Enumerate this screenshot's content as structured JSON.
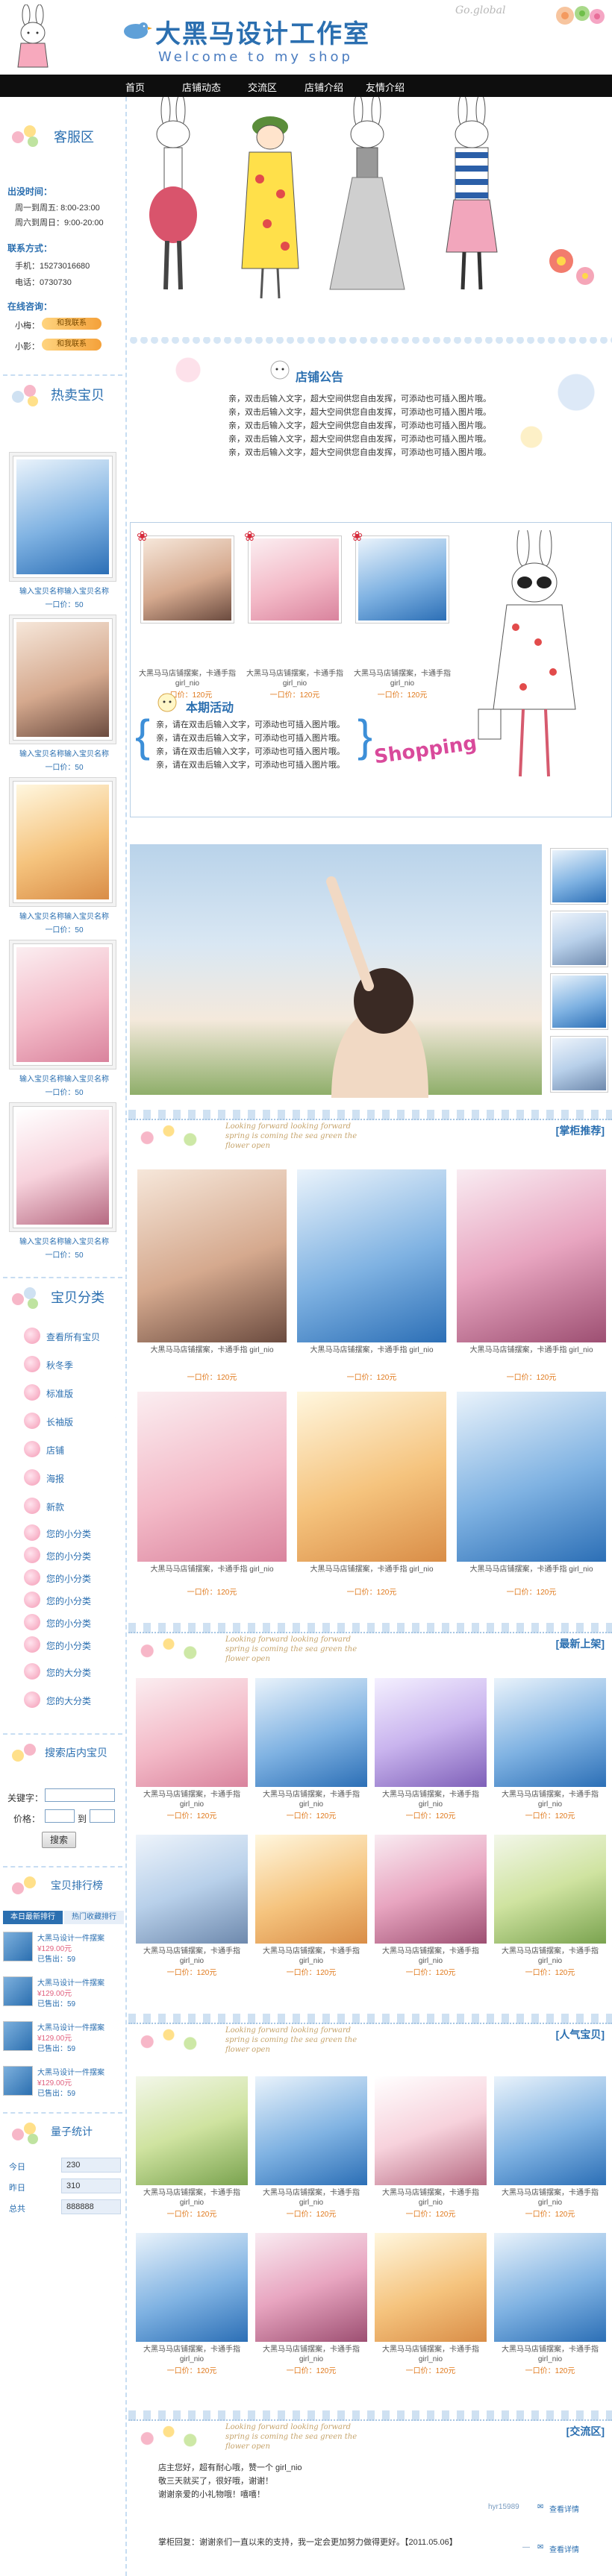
{
  "header": {
    "title": "大黑马设计工作室",
    "subtitle": "Welcome to my shop",
    "script_text": "Go.global"
  },
  "nav": [
    "首页",
    "店铺动态",
    "交流区",
    "店铺介绍",
    "友情介绍"
  ],
  "service": {
    "title": "客服区",
    "hours_label": "出没时间：",
    "weekday_hours": "周一到周五: 8:00-23:00",
    "weekend_hours": "周六到周日：9:00-20:00",
    "contact_label": "联系方式：",
    "phone": "手机：15273016680",
    "tel": "电话：0730730",
    "online_label": "在线咨询：",
    "agents": [
      {
        "name": "小梅：",
        "badge": "和我联系"
      },
      {
        "name": "小影：",
        "badge": "和我联系"
      }
    ]
  },
  "hot": {
    "title": "热卖宝贝",
    "items": [
      {
        "caption": "输入宝贝名称输入宝贝名称",
        "price": "一口价：50"
      },
      {
        "caption": "输入宝贝名称输入宝贝名称",
        "price": "一口价：50"
      },
      {
        "caption": "输入宝贝名称输入宝贝名称",
        "price": "一口价：50"
      },
      {
        "caption": "输入宝贝名称输入宝贝名称",
        "price": "一口价：50"
      },
      {
        "caption": "输入宝贝名称输入宝贝名称",
        "price": "一口价：50"
      }
    ]
  },
  "categories": {
    "title": "宝贝分类",
    "items": [
      "查看所有宝贝",
      "秋冬季",
      "标准版",
      "长袖版",
      "店铺",
      "海报",
      "新款",
      "您的小分类",
      "您的小分类",
      "您的小分类",
      "您的小分类",
      "您的小分类",
      "您的小分类",
      "您的大分类",
      "您的大分类"
    ]
  },
  "search": {
    "title": "搜索店内宝贝",
    "keyword_label": "关键字：",
    "price_label": "价格：",
    "price_sep": "到",
    "button": "搜索"
  },
  "ranking": {
    "title": "宝贝排行榜",
    "tabs": [
      "本日最新排行",
      "热门收藏排行"
    ],
    "items": [
      {
        "name": "大黑马设计一件摆案",
        "price": "¥129.00元",
        "sold": "已售出：59"
      },
      {
        "name": "大黑马设计一件摆案",
        "price": "¥129.00元",
        "sold": "已售出：59"
      },
      {
        "name": "大黑马设计一件摆案",
        "price": "¥129.00元",
        "sold": "已售出：59"
      },
      {
        "name": "大黑马设计一件摆案",
        "price": "¥129.00元",
        "sold": "已售出：59"
      }
    ]
  },
  "stats": {
    "title": "量子统计",
    "rows": [
      {
        "label": "今日",
        "value": "230"
      },
      {
        "label": "昨日",
        "value": "310"
      },
      {
        "label": "总共",
        "value": "888888"
      }
    ]
  },
  "notice": {
    "title": "店铺公告",
    "lines": [
      "亲，双击后输入文字，超大空间供您自由发挥，可添动也可插入图片哦。",
      "亲，双击后输入文字，超大空间供您自由发挥，可添动也可插入图片哦。",
      "亲，双击后输入文字，超大空间供您自由发挥，可添动也可插入图片哦。",
      "亲，双击后输入文字，超大空间供您自由发挥，可添动也可插入图片哦。",
      "亲，双击后输入文字，超大空间供您自由发挥，可添动也可插入图片哦。"
    ]
  },
  "promo": {
    "items": [
      {
        "caption": "大黑马马店铺摆案，卡通手指 girl_nio",
        "price": "一口价：120元"
      },
      {
        "caption": "大黑马马店铺摆案，卡通手指 girl_nio",
        "price": "一口价：120元"
      },
      {
        "caption": "大黑马马店铺摆案，卡通手指 girl_nio",
        "price": "一口价：120元"
      }
    ],
    "activity_title": "本期活动",
    "activity_lines": [
      "亲，请在双击后输入文字，可添动也可插入图片哦。",
      "亲，请在双击后输入文字，可添动也可插入图片哦。",
      "亲，请在双击后输入文字，可添动也可插入图片哦。",
      "亲，请在双击后输入文字，可添动也可插入图片哦。"
    ],
    "shopping_text": "Shopping"
  },
  "section_script": "Looking forward looking forward spring is coming the sea green the flower open",
  "sections": [
    {
      "tag": "[掌柜推荐]",
      "items": [
        {
          "caption": "大黑马马店铺摆案，卡通手指 girl_nio",
          "price": "一口价：120元"
        },
        {
          "caption": "大黑马马店铺摆案，卡通手指 girl_nio",
          "price": "一口价：120元"
        },
        {
          "caption": "大黑马马店铺摆案，卡通手指 girl_nio",
          "price": "一口价：120元"
        },
        {
          "caption": "大黑马马店铺摆案，卡通手指 girl_nio",
          "price": "一口价：120元"
        },
        {
          "caption": "大黑马马店铺摆案，卡通手指 girl_nio",
          "price": "一口价：120元"
        },
        {
          "caption": "大黑马马店铺摆案，卡通手指 girl_nio",
          "price": "一口价：120元"
        }
      ]
    },
    {
      "tag": "[最新上架]",
      "items": [
        {
          "caption": "大黑马马店铺摆案，卡通手指 girl_nio",
          "price": "一口价：120元"
        },
        {
          "caption": "大黑马马店铺摆案，卡通手指 girl_nio",
          "price": "一口价：120元"
        },
        {
          "caption": "大黑马马店铺摆案，卡通手指 girl_nio",
          "price": "一口价：120元"
        },
        {
          "caption": "大黑马马店铺摆案，卡通手指 girl_nio",
          "price": "一口价：120元"
        },
        {
          "caption": "大黑马马店铺摆案，卡通手指 girl_nio",
          "price": "一口价：120元"
        },
        {
          "caption": "大黑马马店铺摆案，卡通手指 girl_nio",
          "price": "一口价：120元"
        },
        {
          "caption": "大黑马马店铺摆案，卡通手指 girl_nio",
          "price": "一口价：120元"
        },
        {
          "caption": "大黑马马店铺摆案，卡通手指 girl_nio",
          "price": "一口价：120元"
        }
      ]
    },
    {
      "tag": "[人气宝贝]",
      "items": [
        {
          "caption": "大黑马马店铺摆案，卡通手指 girl_nio",
          "price": "一口价：120元"
        },
        {
          "caption": "大黑马马店铺摆案，卡通手指 girl_nio",
          "price": "一口价：120元"
        },
        {
          "caption": "大黑马马店铺摆案，卡通手指 girl_nio",
          "price": "一口价：120元"
        },
        {
          "caption": "大黑马马店铺摆案，卡通手指 girl_nio",
          "price": "一口价：120元"
        },
        {
          "caption": "大黑马马店铺摆案，卡通手指 girl_nio",
          "price": "一口价：120元"
        },
        {
          "caption": "大黑马马店铺摆案，卡通手指 girl_nio",
          "price": "一口价：120元"
        },
        {
          "caption": "大黑马马店铺摆案，卡通手指 girl_nio",
          "price": "一口价：120元"
        },
        {
          "caption": "大黑马马店铺摆案，卡通手指 girl_nio",
          "price": "一口价：120元"
        }
      ]
    }
  ],
  "guestbook": {
    "tag": "[交流区]",
    "messages": [
      "店主您好，超有耐心哦，赞一个 girl_nio",
      "敬三天就买了，很好哦，谢谢！",
      "谢谢亲爱的小礼物哦！嘻嘻！"
    ],
    "author": "hyr15989",
    "reply_label": "查看详情",
    "reply_line": "掌柜回复：谢谢亲们一直以来的支持，我一定会更加努力做得更好。【2011.05.06】",
    "reply_author": "—",
    "reply_link": "查看详情"
  },
  "colors": {
    "accent": "#2b6fb0",
    "nav": "#0e0e0e",
    "price": "#e07a1e",
    "pink": "#e24b88"
  }
}
